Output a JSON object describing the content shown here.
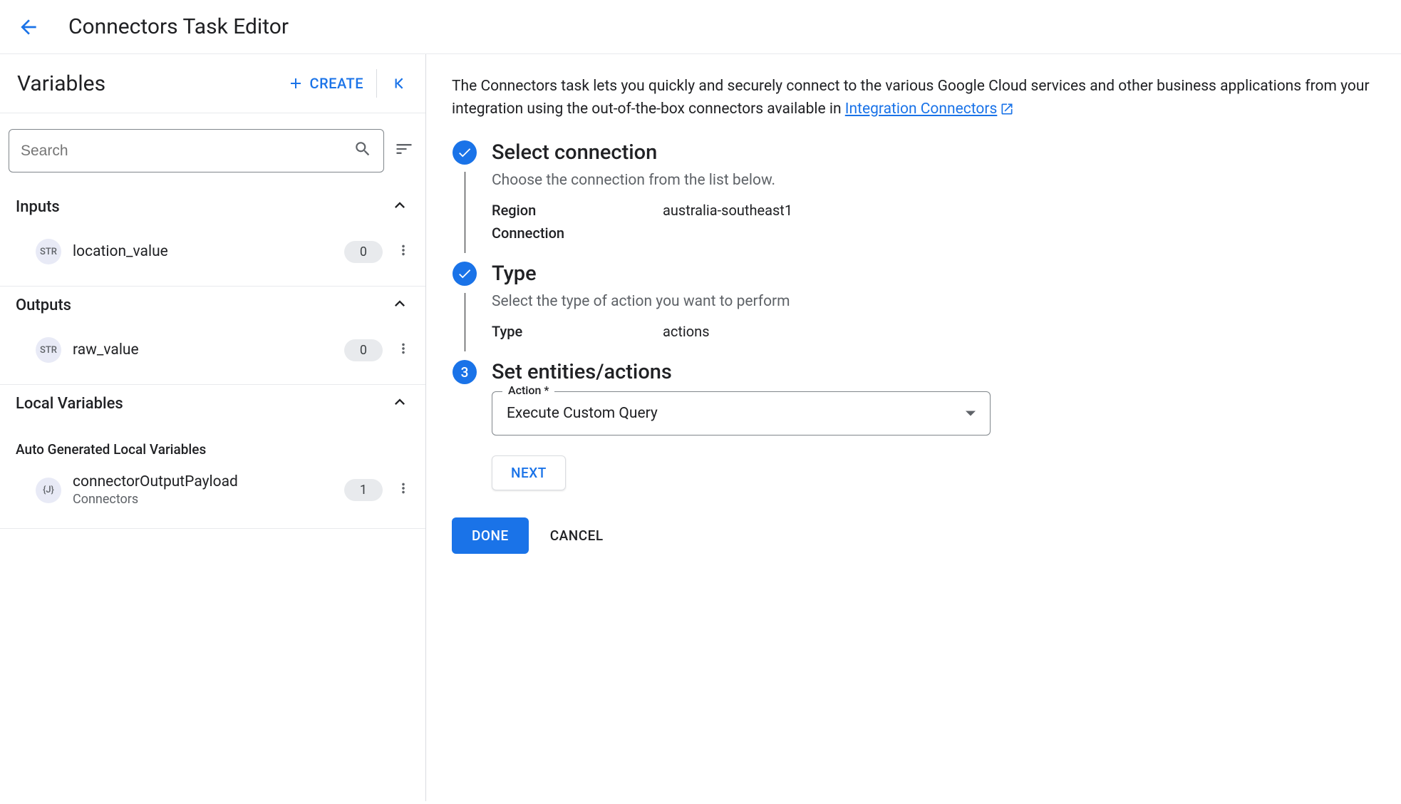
{
  "header": {
    "title": "Connectors Task Editor"
  },
  "leftPanel": {
    "title": "Variables",
    "createLabel": "CREATE",
    "searchPlaceholder": "Search",
    "sections": {
      "inputs": {
        "title": "Inputs",
        "items": [
          {
            "type": "STR",
            "name": "location_value",
            "count": "0"
          }
        ]
      },
      "outputs": {
        "title": "Outputs",
        "items": [
          {
            "type": "STR",
            "name": "raw_value",
            "count": "0"
          }
        ]
      },
      "local": {
        "title": "Local Variables",
        "subtitle": "Auto Generated Local Variables",
        "items": [
          {
            "type": "{J}",
            "name": "connectorOutputPayload",
            "sub": "Connectors",
            "count": "1"
          }
        ]
      }
    }
  },
  "rightPanel": {
    "introPrefix": "The Connectors task lets you quickly and securely connect to the various Google Cloud services and other business applications from your integration using the out-of-the-box connectors available in ",
    "introLink": "Integration Connectors",
    "steps": {
      "s1": {
        "title": "Select connection",
        "desc": "Choose the connection from the list below.",
        "regionLabel": "Region",
        "regionValue": "australia-southeast1",
        "connectionLabel": "Connection"
      },
      "s2": {
        "title": "Type",
        "desc": "Select the type of action you want to perform",
        "typeLabel": "Type",
        "typeValue": "actions"
      },
      "s3": {
        "number": "3",
        "title": "Set entities/actions",
        "actionLabel": "Action *",
        "actionValue": "Execute Custom Query",
        "nextLabel": "NEXT"
      }
    },
    "doneLabel": "DONE",
    "cancelLabel": "CANCEL"
  }
}
